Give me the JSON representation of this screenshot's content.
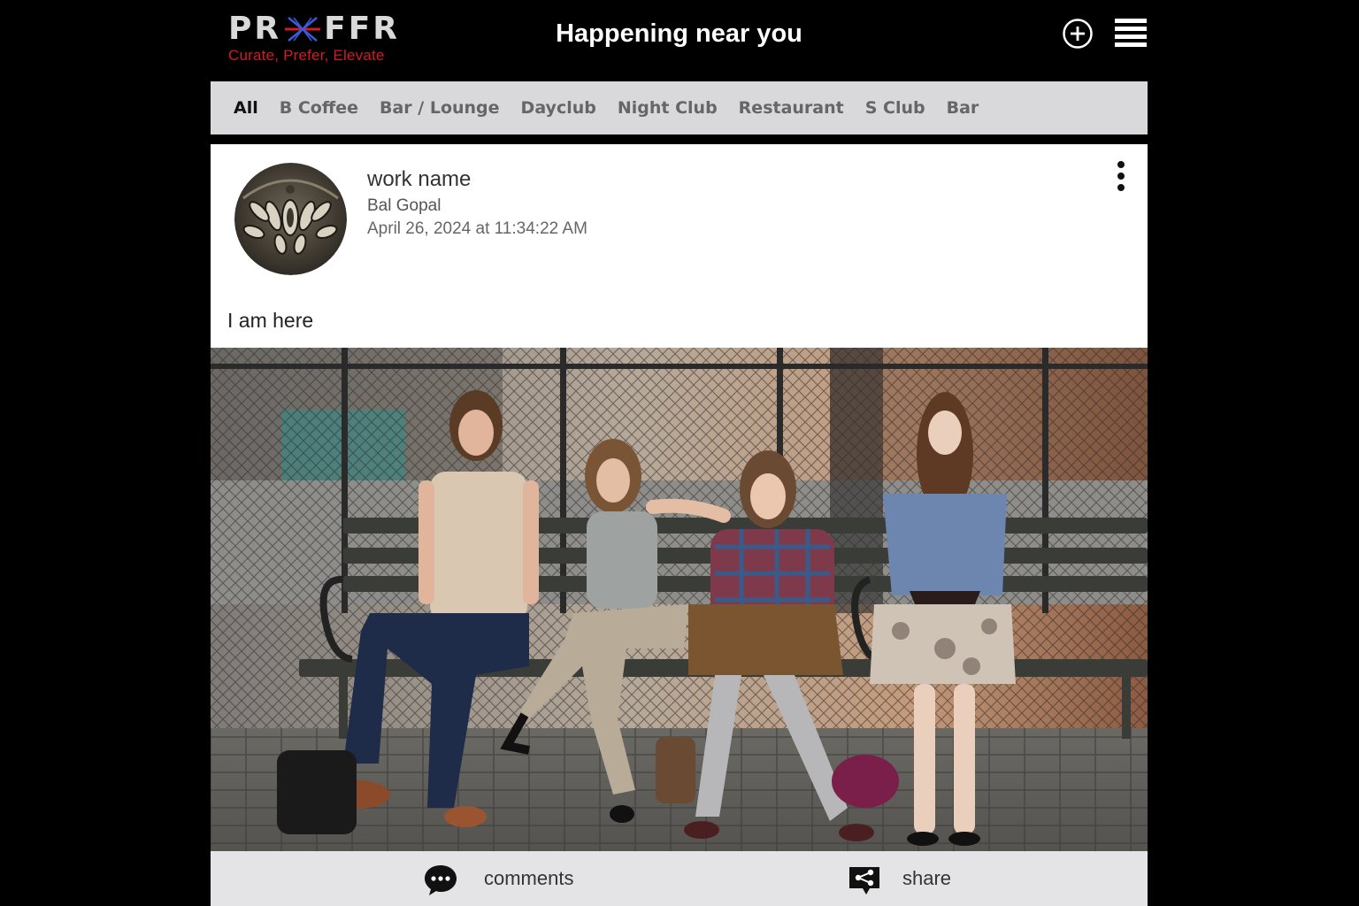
{
  "header": {
    "logo_left": "PR",
    "logo_right": "FFR",
    "tagline": "Curate, Prefer, Elevate",
    "title": "Happening near you",
    "add_icon": "plus-circle-icon",
    "menu_icon": "hamburger-menu-icon"
  },
  "categories": [
    {
      "label": "All",
      "active": true
    },
    {
      "label": "B Coffee"
    },
    {
      "label": "Bar / Lounge"
    },
    {
      "label": "Dayclub"
    },
    {
      "label": "Night Club"
    },
    {
      "label": "Restaurant"
    },
    {
      "label": "S Club"
    },
    {
      "label": "Bar"
    }
  ],
  "post": {
    "work_name": "work name",
    "user": "Bal Gopal",
    "date": "April 26, 2024 at 11:34:22 AM",
    "text": "I am here",
    "menu_icon": "kebab-menu-icon",
    "photo_alt": "Four young women sitting on a park bench in front of a chain-link fence"
  },
  "actions": {
    "comments_label": "comments",
    "comments_icon": "speech-bubble-icon",
    "share_label": "share",
    "share_icon": "share-icon"
  },
  "colors": {
    "background": "#000000",
    "accent_red": "#d41a22",
    "accent_blue": "#3a5bd9",
    "category_bar": "#d9d9dc",
    "action_bar": "#e4e4e6"
  }
}
